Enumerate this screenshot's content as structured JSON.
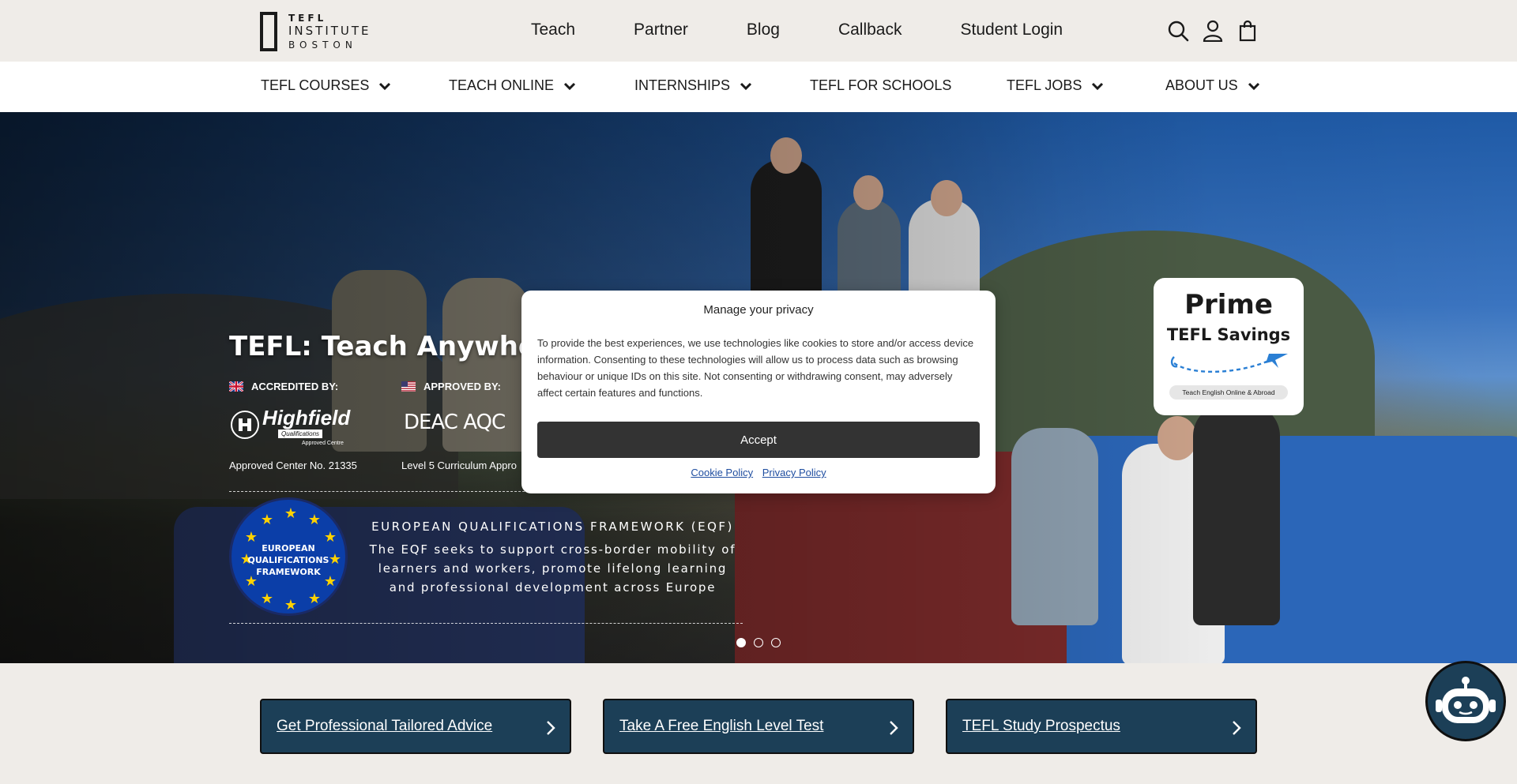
{
  "header": {
    "logo": {
      "line1": "TEFL",
      "line2": "INSTITUTE",
      "line3": "BOSTON"
    },
    "nav": [
      {
        "label": "Teach"
      },
      {
        "label": "Partner"
      },
      {
        "label": "Blog"
      },
      {
        "label": "Callback"
      },
      {
        "label": "Student Login"
      }
    ],
    "icons": [
      "search-icon",
      "user-icon",
      "shopping-bag-icon"
    ]
  },
  "main_nav": [
    {
      "label": "TEFL COURSES",
      "dropdown": true
    },
    {
      "label": "TEACH ONLINE",
      "dropdown": true
    },
    {
      "label": "INTERNSHIPS",
      "dropdown": true
    },
    {
      "label": "TEFL FOR SCHOOLS",
      "dropdown": false
    },
    {
      "label": "TEFL JOBS",
      "dropdown": true
    },
    {
      "label": "ABOUT US",
      "dropdown": true
    }
  ],
  "hero": {
    "title": "TEFL: Teach Anywhere - T",
    "accredited_label": "ACCREDITED BY:",
    "approved_label": "APPROVED BY:",
    "highfield": {
      "name": "Highfield",
      "sub": "Qualifications",
      "tag": "Approved Centre"
    },
    "approved_logos": "DEAC AQC",
    "approved_center_text": "Approved Center No. 21335",
    "curriculum_text": "Level 5 Curriculum Appro",
    "eqf_badge": {
      "line1": "EUROPEAN",
      "line2": "QUALIFICATIONS",
      "line3": "FRAMEWORK"
    },
    "eqf_title": "EUROPEAN QUALIFICATIONS FRAMEWORK (EQF)",
    "eqf_description": "The EQF seeks to support cross-border mobility of learners and workers, promote lifelong learning and professional development across Europe",
    "slides": {
      "count": 3,
      "active": 1
    }
  },
  "prime": {
    "title": "Prime",
    "subtitle": "TEFL Savings",
    "pill": "Teach English Online & Abroad"
  },
  "privacy_modal": {
    "title": "Manage your privacy",
    "text": "To provide the best experiences, we use technologies like cookies to store and/or access device information. Consenting to these technologies will allow us to process data such as browsing behaviour or unique IDs on this site. Not consenting or withdrawing consent, may adversely affect certain features and functions.",
    "accept_label": "Accept",
    "links": [
      {
        "label": "Cookie Policy"
      },
      {
        "label": "Privacy Policy"
      }
    ]
  },
  "ctas": [
    {
      "label": "Get Professional Tailored Advice"
    },
    {
      "label": "Take A Free English Level Test"
    },
    {
      "label": "TEFL Study Prospectus"
    }
  ],
  "colors": {
    "header_bg": "#efece8",
    "cta_bg": "#1c3f57",
    "accept_bg": "#333333",
    "eqf_blue": "#0b3ea8",
    "eqf_star": "#ffd200"
  }
}
